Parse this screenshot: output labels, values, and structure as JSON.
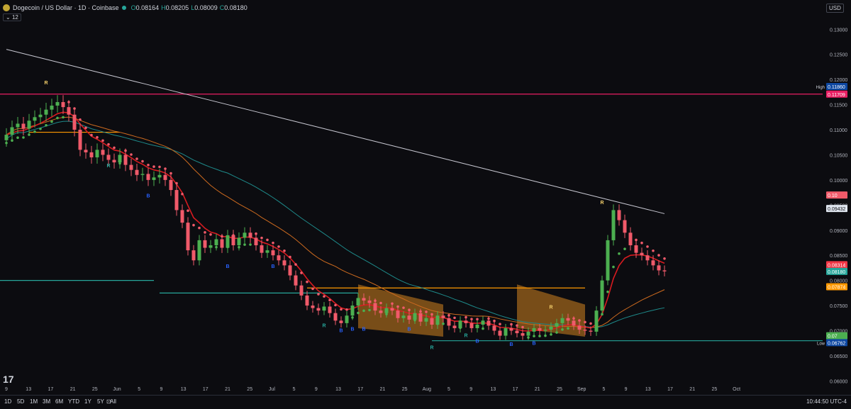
{
  "header": {
    "title": "Dogecoin / US Dollar · 1D · Coinbase",
    "o_label": "O",
    "o_value": "0.08164",
    "h_label": "H",
    "h_value": "0.08205",
    "l_label": "L",
    "l_value": "0.08009",
    "c_label": "C",
    "c_value": "0.08180",
    "indicator_count": "12"
  },
  "currency": "USD",
  "timeframes": [
    "1D",
    "5D",
    "1M",
    "3M",
    "6M",
    "YTD",
    "1Y",
    "5Y",
    "All"
  ],
  "clock": "10:44:50 UTC-4",
  "colors": {
    "up": "#4caf50",
    "down": "#f05a6a",
    "up_alt": "#26a69a",
    "bg": "#0c0c10",
    "ma200": "#c9c9d2",
    "ma100": "#1e8a8a",
    "ma50": "#cc6a1f",
    "ema": "#d81b20"
  },
  "chart_data": {
    "type": "candlestick",
    "x": [
      "May 9",
      "May 10",
      "May 11",
      "May 12",
      "May 13",
      "May 14",
      "May 15",
      "May 16",
      "May 17",
      "May 18",
      "May 19",
      "May 20",
      "May 21",
      "May 22",
      "May 23",
      "May 24",
      "May 25",
      "May 26",
      "May 27",
      "May 28",
      "May 29",
      "May 30",
      "May 31",
      "Jun 1",
      "Jun 2",
      "Jun 3",
      "Jun 4",
      "Jun 5",
      "Jun 6",
      "Jun 7",
      "Jun 8",
      "Jun 9",
      "Jun 10",
      "Jun 11",
      "Jun 12",
      "Jun 13",
      "Jun 14",
      "Jun 15",
      "Jun 16",
      "Jun 17",
      "Jun 18",
      "Jun 19",
      "Jun 20",
      "Jun 21",
      "Jun 22",
      "Jun 23",
      "Jun 24",
      "Jun 25",
      "Jun 26",
      "Jun 27",
      "Jun 28",
      "Jun 29",
      "Jun 30",
      "Jul 1",
      "Jul 2",
      "Jul 3",
      "Jul 4",
      "Jul 5",
      "Jul 6",
      "Jul 7",
      "Jul 8",
      "Jul 9",
      "Jul 10",
      "Jul 11",
      "Jul 12",
      "Jul 13",
      "Jul 14",
      "Jul 15",
      "Jul 16",
      "Jul 17",
      "Jul 18",
      "Jul 19",
      "Jul 20",
      "Jul 21",
      "Jul 22",
      "Jul 23",
      "Jul 24",
      "Jul 25",
      "Jul 26",
      "Jul 27",
      "Jul 28",
      "Jul 29",
      "Jul 30",
      "Jul 31",
      "Aug 1",
      "Aug 2",
      "Aug 3",
      "Aug 4",
      "Aug 5",
      "Aug 6",
      "Aug 7",
      "Aug 8",
      "Aug 9",
      "Aug 10",
      "Aug 11",
      "Aug 12",
      "Aug 13",
      "Aug 14",
      "Aug 15",
      "Aug 16",
      "Aug 17",
      "Aug 18",
      "Aug 19",
      "Aug 20",
      "Aug 21",
      "Aug 22",
      "Aug 23",
      "Aug 24",
      "Aug 25",
      "Aug 26",
      "Aug 27",
      "Aug 28",
      "Aug 29",
      "Aug 30",
      "Aug 31",
      "Sep 1"
    ],
    "close": [
      0.109,
      0.1105,
      0.1112,
      0.1102,
      0.1118,
      0.1125,
      0.113,
      0.114,
      0.1148,
      0.1155,
      0.1145,
      0.113,
      0.11,
      0.106,
      0.1055,
      0.1045,
      0.106,
      0.105,
      0.104,
      0.1035,
      0.105,
      0.103,
      0.102,
      0.101,
      0.1012,
      0.1,
      0.1005,
      0.101,
      0.1,
      0.098,
      0.094,
      0.0915,
      0.086,
      0.084,
      0.088,
      0.0865,
      0.087,
      0.0882,
      0.0865,
      0.089,
      0.087,
      0.0885,
      0.0895,
      0.0885,
      0.087,
      0.0855,
      0.086,
      0.085,
      0.084,
      0.083,
      0.081,
      0.079,
      0.077,
      0.075,
      0.0745,
      0.074,
      0.0748,
      0.0735,
      0.072,
      0.0715,
      0.073,
      0.075,
      0.0765,
      0.076,
      0.0755,
      0.074,
      0.0735,
      0.0745,
      0.074,
      0.0725,
      0.073,
      0.0722,
      0.0735,
      0.0718,
      0.0725,
      0.0712,
      0.073,
      0.0725,
      0.071,
      0.0705,
      0.072,
      0.0715,
      0.0705,
      0.0712,
      0.072,
      0.071,
      0.07,
      0.069,
      0.0705,
      0.07,
      0.0695,
      0.069,
      0.0698,
      0.0705,
      0.07,
      0.0702,
      0.0708,
      0.0715,
      0.0725,
      0.072,
      0.071,
      0.0702,
      0.07,
      0.0698,
      0.074,
      0.08,
      0.088,
      0.094,
      0.092,
      0.0895,
      0.087,
      0.0855,
      0.085,
      0.084,
      0.083,
      0.082,
      0.0818
    ],
    "labels": {
      "high": "High",
      "low": "Low"
    },
    "y_ticks": [
      "0.13000",
      "0.12500",
      "0.12000",
      "0.11500",
      "0.11000",
      "0.10500",
      "0.10000",
      "0.09500",
      "0.09000",
      "0.08500",
      "0.08000",
      "0.07500",
      "0.07000",
      "0.06500",
      "0.06000"
    ],
    "y_range": [
      0.0585,
      0.133
    ],
    "price_tags": [
      {
        "label": "High",
        "value": "0.11860",
        "color": "#0d47a1",
        "price": 0.1186
      },
      {
        "label": "",
        "value": "0.11709",
        "color": "#e91e63",
        "price": 0.11709
      },
      {
        "label": "",
        "value": "0.10",
        "color": "#f05a6a",
        "price": 0.097
      },
      {
        "label": "",
        "value": "0.09432",
        "color": "#e0e6f0",
        "price": 0.09432
      },
      {
        "label": "",
        "value": "0.08314",
        "color": "#f23645",
        "price": 0.08314
      },
      {
        "label": "",
        "value": "0.08180",
        "color": "#26a69a",
        "price": 0.0818
      },
      {
        "label": "",
        "value": "0.07874",
        "color": "#ff9800",
        "price": 0.07874
      },
      {
        "label": "",
        "value": "0.07",
        "color": "#4caf50",
        "price": 0.069
      },
      {
        "label": "Low",
        "value": "0.06762",
        "color": "#0d47a1",
        "price": 0.06762
      }
    ],
    "h_levels": [
      {
        "price": 0.11709,
        "color": "#e91e63",
        "from": "May 9",
        "to": "Sep 1"
      },
      {
        "price": 0.1095,
        "color": "#ff9800",
        "from": "May 13",
        "to": "May 29"
      },
      {
        "price": 0.08,
        "color": "#26a69a",
        "from": "May 9",
        "to": "Jun 4"
      },
      {
        "price": 0.0775,
        "color": "#26a69a",
        "from": "Jun 5",
        "to": "Jul 10"
      },
      {
        "price": 0.0785,
        "color": "#ff9800",
        "from": "Jul 1",
        "to": "Aug 19"
      },
      {
        "price": 0.068,
        "color": "#26a69a",
        "from": "Jul 23",
        "to": "Sep 1"
      }
    ],
    "x_ticks": [
      "9",
      "13",
      "17",
      "21",
      "25",
      "Jun",
      "5",
      "9",
      "13",
      "17",
      "21",
      "25",
      "Jul",
      "5",
      "9",
      "13",
      "17",
      "21",
      "25",
      "Aug",
      "5",
      "9",
      "13",
      "17",
      "21",
      "25",
      "Sep",
      "5",
      "9",
      "13",
      "17",
      "21",
      "25",
      "Oct"
    ],
    "annotations": [
      {
        "text": "R",
        "date": "May 16",
        "price": 0.119,
        "color": "#f5d06b"
      },
      {
        "text": "R",
        "date": "May 27",
        "price": 0.1025,
        "color": "#26a69a"
      },
      {
        "text": "B",
        "date": "Jun 3",
        "price": 0.0965,
        "color": "#2962ff"
      },
      {
        "text": "B",
        "date": "Jun 17",
        "price": 0.0825,
        "color": "#2962ff"
      },
      {
        "text": "B",
        "date": "Jun 25",
        "price": 0.0825,
        "color": "#2962ff"
      },
      {
        "text": "R",
        "date": "Jul 4",
        "price": 0.0707,
        "color": "#26a69a"
      },
      {
        "text": "B",
        "date": "Jul 7",
        "price": 0.0697,
        "color": "#2962ff"
      },
      {
        "text": "B",
        "date": "Jul 9",
        "price": 0.07,
        "color": "#2962ff"
      },
      {
        "text": "B",
        "date": "Jul 11",
        "price": 0.07,
        "color": "#2962ff"
      },
      {
        "text": "B",
        "date": "Jul 19",
        "price": 0.07,
        "color": "#2962ff"
      },
      {
        "text": "R",
        "date": "Jul 23",
        "price": 0.0663,
        "color": "#26a69a"
      },
      {
        "text": "R",
        "date": "Jul 29",
        "price": 0.0687,
        "color": "#26a69a"
      },
      {
        "text": "B",
        "date": "Jul 31",
        "price": 0.0676,
        "color": "#2962ff"
      },
      {
        "text": "B",
        "date": "Aug 6",
        "price": 0.067,
        "color": "#2962ff"
      },
      {
        "text": "B",
        "date": "Aug 10",
        "price": 0.0672,
        "color": "#2962ff"
      },
      {
        "text": "R",
        "date": "Aug 13",
        "price": 0.0744,
        "color": "#f5d06b"
      },
      {
        "text": "R",
        "date": "Aug 22",
        "price": 0.0952,
        "color": "#f5d06b"
      }
    ]
  }
}
